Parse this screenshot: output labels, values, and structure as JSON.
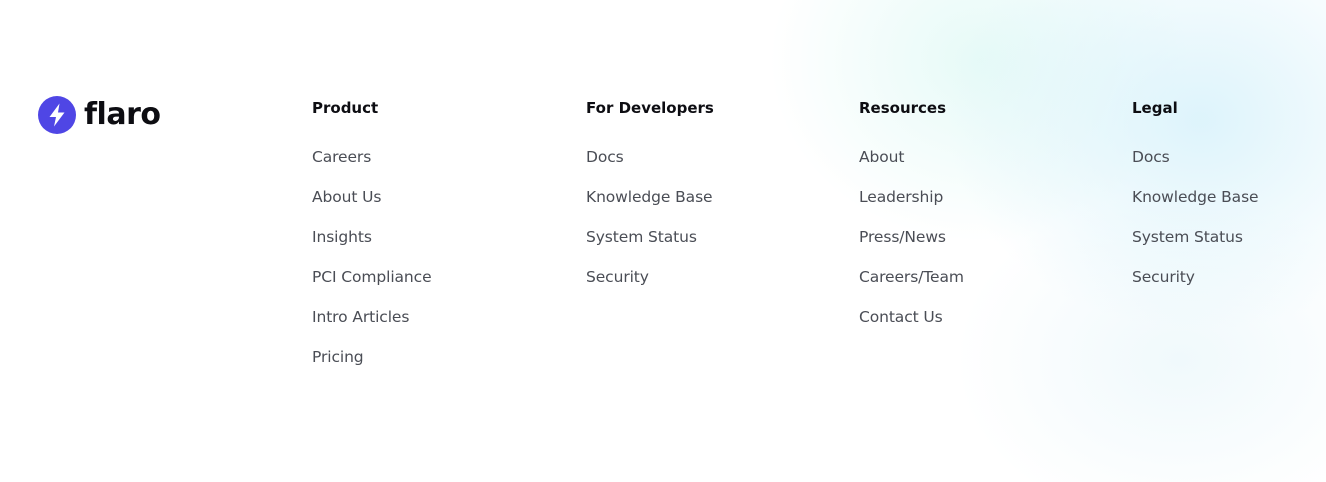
{
  "brand": {
    "name": "flaro",
    "accent": "#4f46e5",
    "logo_icon": "lightning-bolt-icon"
  },
  "columns": [
    {
      "title": "Product",
      "links": [
        "Careers",
        "About Us",
        "Insights",
        "PCI Compliance",
        "Intro Articles",
        "Pricing"
      ]
    },
    {
      "title": "For Developers",
      "links": [
        "Docs",
        "Knowledge Base",
        "System Status",
        "Security"
      ]
    },
    {
      "title": "Resources",
      "links": [
        "About",
        "Leadership",
        "Press/News",
        "Careers/Team",
        "Contact Us"
      ]
    },
    {
      "title": "Legal",
      "links": [
        "Docs",
        "Knowledge Base",
        "System Status",
        "Security"
      ]
    }
  ],
  "colors": {
    "heading": "#0d0d12",
    "link": "#4a4d55",
    "background": "#ffffff"
  }
}
